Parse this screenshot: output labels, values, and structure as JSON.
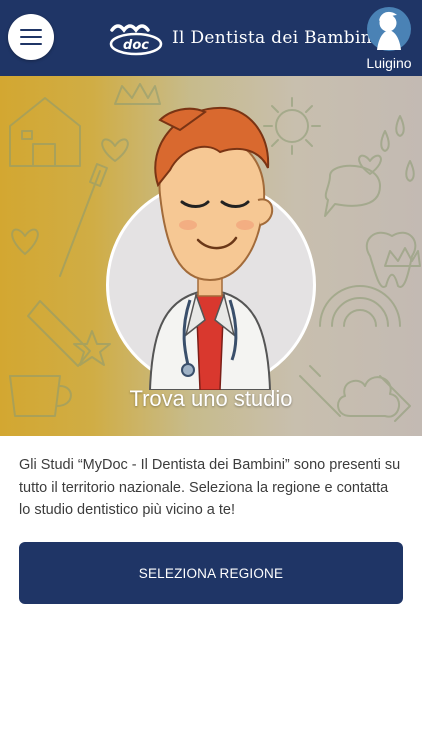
{
  "header": {
    "menu_icon": "hamburger-menu-icon",
    "brand": {
      "logo_text": "doc",
      "name": "Il Dentista dei Bambini"
    },
    "user": {
      "avatar_icon": "child-avatar-icon",
      "name": "Luigino"
    }
  },
  "hero": {
    "title": "Trova uno studio",
    "illustration": "cartoon-dentist-character"
  },
  "main": {
    "intro_text": "Gli Studi “MyDoc - Il Dentista dei Bambini” sono presenti su tutto il territorio nazionale. Seleziona la regione e contatta lo studio dentistico più vicino a te!",
    "region_button_label": "SELEZIONA REGIONE"
  },
  "colors": {
    "primary_navy": "#1f3566",
    "hero_gold": "#d3a731",
    "text": "#3c3c3c",
    "white": "#ffffff"
  }
}
